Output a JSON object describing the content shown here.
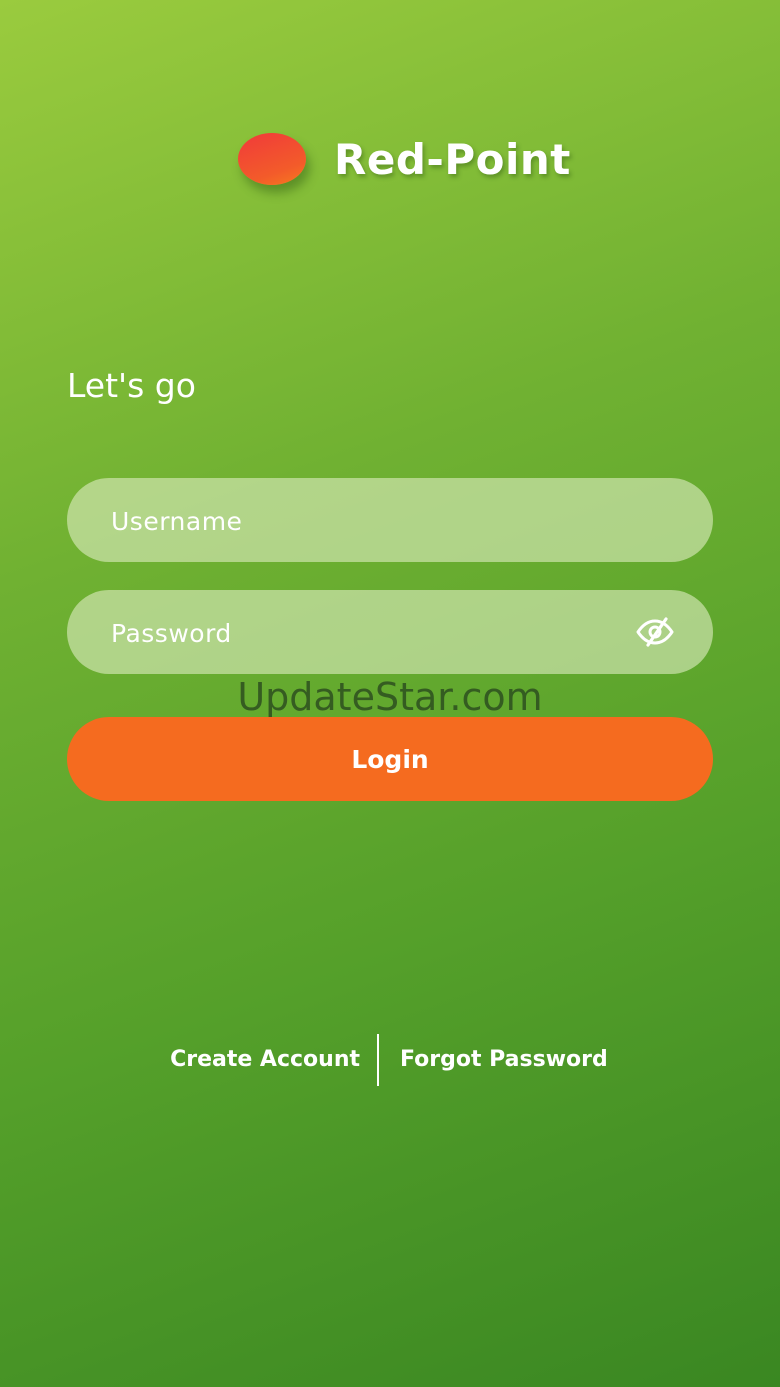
{
  "header": {
    "brand_name": "Red-Point",
    "logo_icon": "red-dot-logo",
    "logo_color": "#f03a3a"
  },
  "main": {
    "greeting": "Let's go",
    "username": {
      "placeholder": "Username",
      "value": ""
    },
    "password": {
      "placeholder": "Password",
      "value": "",
      "toggle_icon": "eye-hidden-icon"
    },
    "login_label": "Login",
    "login_color": "#f56b1f"
  },
  "footer": {
    "create_account_label": "Create Account",
    "forgot_password_label": "Forgot Password"
  },
  "watermark": "UpdateStar.com",
  "colors": {
    "background_top": "#9acb3e",
    "background_bottom": "#3a8722",
    "accent": "#f56b1f"
  }
}
